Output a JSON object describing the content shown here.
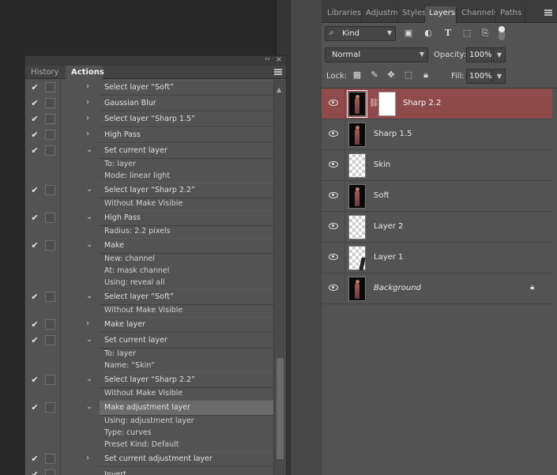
{
  "actions_panel": {
    "tabs": [
      {
        "label": "History",
        "active": false
      },
      {
        "label": "Actions",
        "active": true
      }
    ],
    "collapse_icon": "double-chevron-left",
    "close_icon": "×",
    "rows": [
      {
        "type": "main",
        "checked": true,
        "expander": "›",
        "label": "Select layer “Soft”"
      },
      {
        "type": "main",
        "checked": true,
        "expander": "›",
        "label": "Gaussian Blur"
      },
      {
        "type": "main",
        "checked": true,
        "expander": "›",
        "label": "Select layer “Sharp 1.5”"
      },
      {
        "type": "main",
        "checked": true,
        "expander": "›",
        "label": "High Pass"
      },
      {
        "type": "main",
        "checked": true,
        "expander": "⌄",
        "label": "Set current layer"
      },
      {
        "type": "sub",
        "label": "To: layer"
      },
      {
        "type": "sub",
        "label": "Mode: linear light"
      },
      {
        "type": "main",
        "checked": true,
        "expander": "⌄",
        "label": "Select layer “Sharp 2.2”"
      },
      {
        "type": "sub",
        "label": "Without Make Visible"
      },
      {
        "type": "main",
        "checked": true,
        "expander": "⌄",
        "label": "High Pass"
      },
      {
        "type": "sub",
        "label": "Radius: 2.2 pixels"
      },
      {
        "type": "main",
        "checked": true,
        "expander": "⌄",
        "label": "Make"
      },
      {
        "type": "sub",
        "label": "New: channel"
      },
      {
        "type": "sub",
        "label": "At: mask channel"
      },
      {
        "type": "sub",
        "label": "Using: reveal all"
      },
      {
        "type": "main",
        "checked": true,
        "expander": "⌄",
        "label": "Select layer “Soft”"
      },
      {
        "type": "sub",
        "label": "Without Make Visible"
      },
      {
        "type": "main",
        "checked": true,
        "expander": "›",
        "label": "Make layer"
      },
      {
        "type": "main",
        "checked": true,
        "expander": "⌄",
        "label": "Set current layer"
      },
      {
        "type": "sub",
        "label": "To: layer"
      },
      {
        "type": "sub",
        "label": "Name:  “Skin”"
      },
      {
        "type": "main",
        "checked": true,
        "expander": "⌄",
        "label": "Select layer “Sharp 2.2”"
      },
      {
        "type": "sub",
        "label": "Without Make Visible"
      },
      {
        "type": "main",
        "checked": true,
        "expander": "⌄",
        "label": "Make adjustment layer",
        "selected": true
      },
      {
        "type": "sub",
        "label": "Using: adjustment layer"
      },
      {
        "type": "sub",
        "label": "Type: curves"
      },
      {
        "type": "sub",
        "label": "Preset Kind: Default"
      },
      {
        "type": "main",
        "checked": true,
        "expander": "›",
        "label": "Set current adjustment layer"
      },
      {
        "type": "main",
        "checked": true,
        "expander": "",
        "label": "Invert"
      }
    ]
  },
  "layers_panel": {
    "tabs": [
      {
        "label": "Libraries",
        "active": false
      },
      {
        "label": "Adjustm",
        "active": false
      },
      {
        "label": "Styles",
        "active": false
      },
      {
        "label": "Layers",
        "active": true
      },
      {
        "label": "Channels",
        "active": false
      },
      {
        "label": "Paths",
        "active": false
      }
    ],
    "filter": {
      "label": "Kind",
      "icon": "search-icon"
    },
    "blend_mode": "Normal",
    "opacity_label": "Opacity:",
    "opacity_value": "100%",
    "lock_label": "Lock:",
    "fill_label": "Fill:",
    "fill_value": "100%",
    "layers": [
      {
        "name": "Sharp 2.2",
        "thumb": "photo",
        "has_mask": true,
        "selected": true,
        "visible": true,
        "italic": false,
        "locked": false
      },
      {
        "name": "Sharp 1.5",
        "thumb": "photo",
        "has_mask": false,
        "selected": false,
        "visible": true,
        "italic": false,
        "locked": false
      },
      {
        "name": "Skin",
        "thumb": "transparent",
        "has_mask": false,
        "selected": false,
        "visible": true,
        "italic": false,
        "locked": false
      },
      {
        "name": "Soft",
        "thumb": "photo",
        "has_mask": false,
        "selected": false,
        "visible": true,
        "italic": false,
        "locked": false
      },
      {
        "name": "Layer 2",
        "thumb": "transparent",
        "has_mask": false,
        "selected": false,
        "visible": true,
        "italic": false,
        "locked": false
      },
      {
        "name": "Layer 1",
        "thumb": "transparent-sliver",
        "has_mask": false,
        "selected": false,
        "visible": true,
        "italic": false,
        "locked": false
      },
      {
        "name": "Background",
        "thumb": "photo",
        "has_mask": false,
        "selected": false,
        "visible": true,
        "italic": true,
        "locked": true
      }
    ]
  },
  "colors": {
    "selected_layer": "#8f4b4b",
    "panel_bg": "#535353",
    "selected_action": "#6b6b6b"
  }
}
